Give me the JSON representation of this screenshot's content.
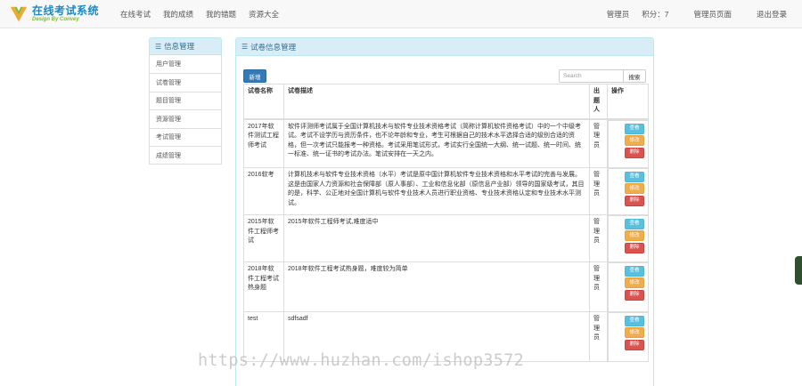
{
  "brand": {
    "title": "在线考试系统",
    "subtitle": "Design By Convey"
  },
  "nav": {
    "items": [
      "在线考试",
      "我的成绩",
      "我的错题",
      "资源大全"
    ]
  },
  "user": {
    "role": "管理员",
    "score_label": "积分：7",
    "admin_page": "管理员页面",
    "logout": "退出登录"
  },
  "sidebar": {
    "title": "信息管理",
    "items": [
      "用户管理",
      "试卷管理",
      "题目管理",
      "资源管理",
      "考试管理",
      "成绩管理"
    ]
  },
  "main": {
    "title": "试卷信息管理",
    "new_button": "新增",
    "search": {
      "placeholder": "Search",
      "button": "搜索"
    },
    "columns": {
      "name": "试卷名称",
      "desc": "试卷描述",
      "publisher": "出题人",
      "ops": "操作"
    },
    "rows": [
      {
        "name": "2017年软件测试工程师考试",
        "desc": "软件评测师考试属于全国计算机技术与软件专业技术资格考试（简称计算机软件资格考试）中的一个中级考试。考试不设学历与资历条件，也不论年龄和专业，考生可根据自己的技术水平选择合适的级别合适的资格，但一次考试只能报考一种资格。考试采用笔试形式，考试实行全国统一大纲、统一试题、统一时间、统一标准、统一证书的考试办法。笔试安排在一天之内。",
        "publisher": "管理员"
      },
      {
        "name": "2016软考",
        "desc": "计算机技术与软件专业技术资格（水平）考试是原中国计算机软件专业技术资格和水平考试的完善与发展。这是由国家人力资源和社会保障部（原人事部）、工业和信息化部（原信息产业部）领导的国家级考试，其目的是，科学、公正地对全国计算机与软件专业技术人员进行职业资格、专业技术资格认定和专业技术水平测试。",
        "publisher": "管理员"
      },
      {
        "name": "2015年软件工程师考试",
        "desc": "2015年软件工程师考试,难度适中",
        "publisher": "管理员"
      },
      {
        "name": "2018年软件工程考试热身题",
        "desc": "2018年软件工程考试热身题，难度较为简单",
        "publisher": "管理员"
      },
      {
        "name": "test",
        "desc": "sdfsadf",
        "publisher": "管理员"
      }
    ],
    "row_actions": {
      "view": "查看",
      "edit": "修改",
      "delete": "删除"
    }
  },
  "watermark": "https://www.huzhan.com/ishop3572",
  "colors": {
    "brand_blue": "#1e88c7",
    "panel_head_bg": "#d9edf7",
    "primary": "#337ab7",
    "info": "#5bc0de",
    "warning": "#f0ad4e",
    "danger": "#d9534f"
  }
}
